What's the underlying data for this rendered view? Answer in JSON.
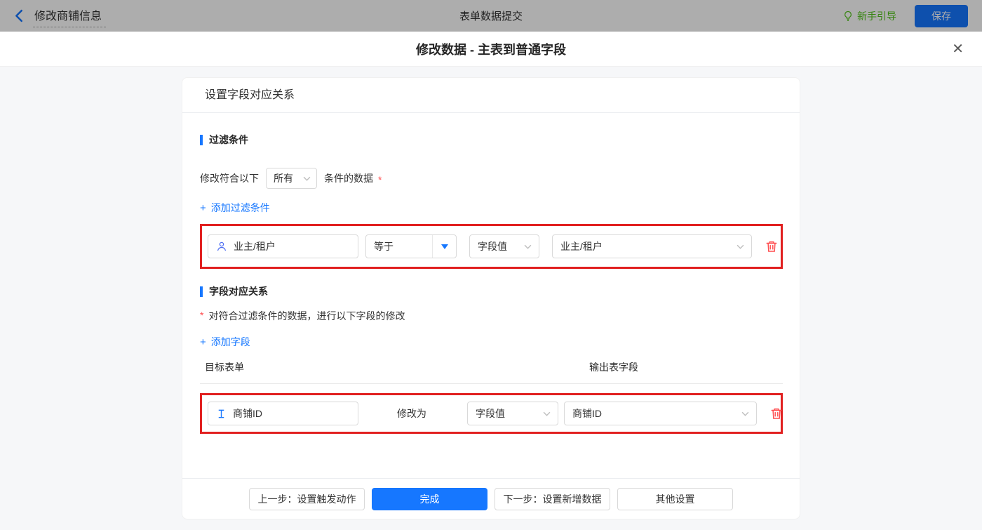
{
  "header": {
    "back_label": "修改商铺信息",
    "title": "表单数据提交",
    "guide_label": "新手引导",
    "save_label": "保存"
  },
  "modal": {
    "title": "修改数据 - 主表到普通字段",
    "close_glyph": "✕"
  },
  "card": {
    "header_title": "设置字段对应关系",
    "filter_section": {
      "title": "过滤条件",
      "match_prefix": "修改符合以下",
      "match_mode": "所有",
      "match_suffix": "条件的数据",
      "required_mark": "*",
      "add_icon": "+",
      "add_label": "添加过滤条件",
      "condition_row": {
        "field": "业主/租户",
        "operator": "等于",
        "value_type": "字段值",
        "value": "业主/租户"
      }
    },
    "mapping_section": {
      "title": "字段对应关系",
      "required_mark": "*",
      "description": "对符合过滤条件的数据，进行以下字段的修改",
      "add_icon": "+",
      "add_label": "添加字段",
      "col_target": "目标表单",
      "col_output": "输出表字段",
      "row": {
        "field": "商铺ID",
        "action": "修改为",
        "value_type": "字段值",
        "value": "商铺ID"
      }
    },
    "footer": {
      "prev_label": "上一步：设置触发动作",
      "done_label": "完成",
      "next_label": "下一步：设置新增数据",
      "other_label": "其他设置"
    }
  },
  "colors": {
    "primary_blue": "#1677ff",
    "guide_green": "#52c41a",
    "annotation_red": "#e12020",
    "danger_red": "#ff4d4f"
  }
}
